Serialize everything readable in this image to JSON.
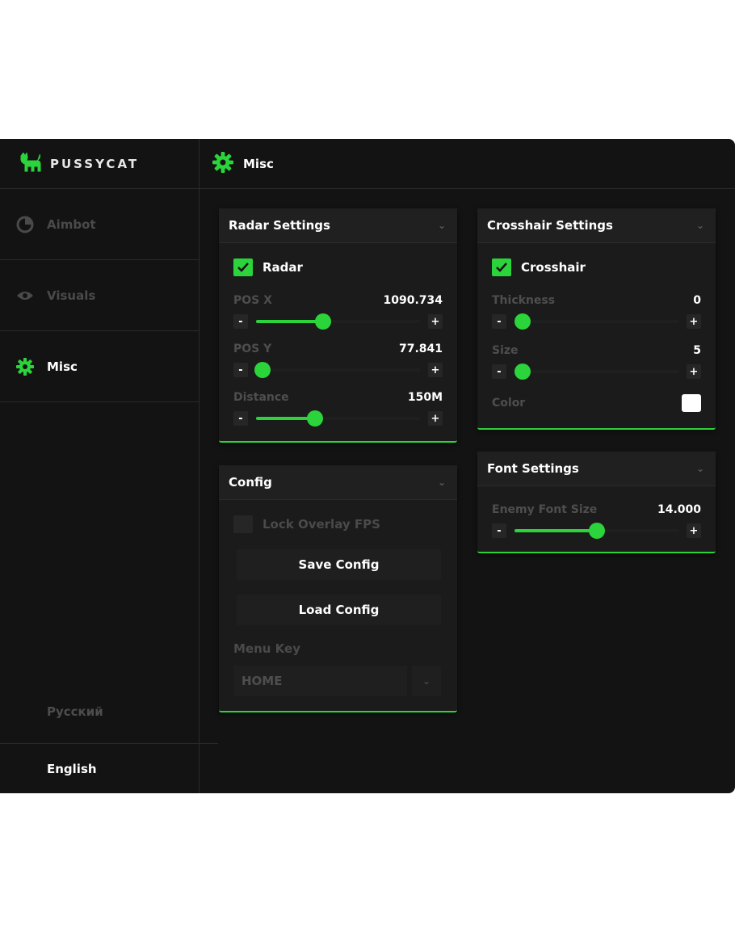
{
  "app": {
    "name": "PUSSYCAT",
    "accent": "#2bd43a"
  },
  "sidebar": {
    "items": [
      {
        "label": "Aimbot",
        "icon": "aimbot-icon",
        "active": false
      },
      {
        "label": "Visuals",
        "icon": "eye-icon",
        "active": false
      },
      {
        "label": "Misc",
        "icon": "gear-icon",
        "active": true
      }
    ],
    "languages": [
      "Русский",
      "English"
    ]
  },
  "header": {
    "title": "Misc",
    "icon": "gear-icon"
  },
  "radar": {
    "title": "Radar Settings",
    "toggle_label": "Radar",
    "toggle_checked": true,
    "pos_x": {
      "label": "POS X",
      "value": "1090.734",
      "fraction": 0.41
    },
    "pos_y": {
      "label": "POS Y",
      "value": "77.841",
      "fraction": 0.04
    },
    "distance": {
      "label": "Distance",
      "value": "150M",
      "fraction": 0.36
    }
  },
  "config": {
    "title": "Config",
    "lock_fps_label": "Lock Overlay FPS",
    "lock_fps_checked": false,
    "save_label": "Save Config",
    "load_label": "Load Config",
    "menu_key_label": "Menu Key",
    "menu_key_value": "HOME"
  },
  "crosshair": {
    "title": "Crosshair Settings",
    "toggle_label": "Crosshair",
    "toggle_checked": true,
    "thickness": {
      "label": "Thickness",
      "value": "0",
      "fraction": 0.0
    },
    "size": {
      "label": "Size",
      "value": "5",
      "fraction": 0.0
    },
    "color_label": "Color",
    "color_value": "#ffffff"
  },
  "font": {
    "title": "Font Settings",
    "enemy_font_size": {
      "label": "Enemy Font Size",
      "value": "14.000",
      "fraction": 0.5
    }
  },
  "steppers": {
    "minus": "-",
    "plus": "+"
  }
}
